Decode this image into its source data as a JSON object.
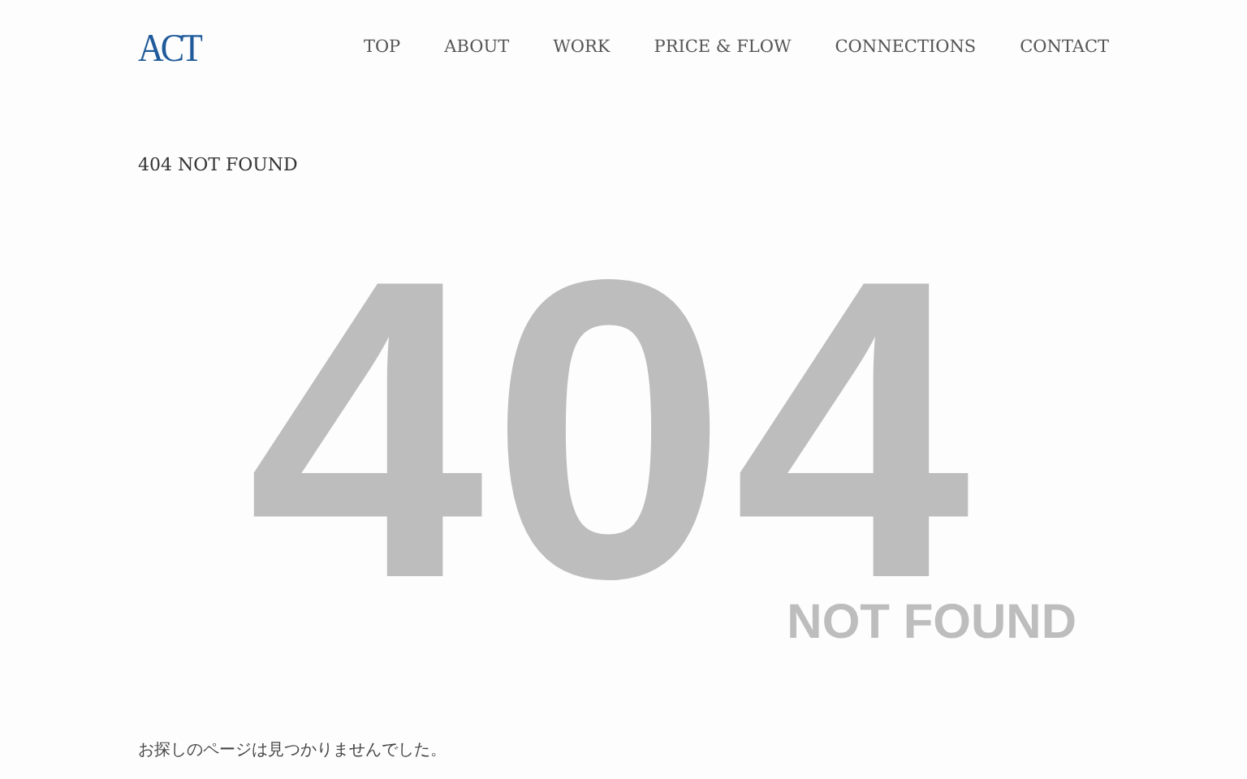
{
  "logo": "ACT",
  "nav": [
    {
      "label": "TOP"
    },
    {
      "label": "ABOUT"
    },
    {
      "label": "WORK"
    },
    {
      "label": "PRICE & FLOW"
    },
    {
      "label": "CONNECTIONS"
    },
    {
      "label": "CONTACT"
    }
  ],
  "page_title": "404 NOT FOUND",
  "hero": {
    "code": "404",
    "caption": "NOT FOUND"
  },
  "message": "お探しのページは見つかりませんでした。"
}
